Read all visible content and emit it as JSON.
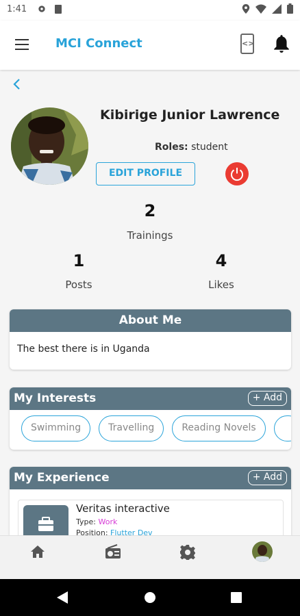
{
  "status_bar": {
    "time": "1:41"
  },
  "app_bar": {
    "title": "MCI Connect"
  },
  "profile": {
    "name": "Kibirige Junior Lawrence",
    "roles_label": "Roles:",
    "roles_value": "student",
    "edit_label": "EDIT PROFILE"
  },
  "stats": {
    "trainings": {
      "value": "2",
      "label": "Trainings"
    },
    "posts": {
      "value": "1",
      "label": "Posts"
    },
    "likes": {
      "value": "4",
      "label": "Likes"
    }
  },
  "about": {
    "title": "About Me",
    "text": "The best there is in Uganda"
  },
  "interests": {
    "title": "My Interests",
    "add_label": "+ Add",
    "items": [
      "Swimming",
      "Travelling",
      "Reading Novels"
    ]
  },
  "experience": {
    "title": "My Experience",
    "add_label": "+ Add",
    "items": [
      {
        "title": "Veritas interactive",
        "type_label": "Type:",
        "type_value": "Work",
        "position_label": "Position:",
        "position_value": "Flutter Dev"
      }
    ]
  },
  "colors": {
    "accent": "#29a3d9",
    "card_header": "#5c7684",
    "power": "#ea3b32",
    "type_value": "#d63ad6"
  },
  "icons": [
    "menu-icon",
    "code-icon",
    "bell-icon",
    "back-icon",
    "power-icon",
    "home-icon",
    "radio-icon",
    "gear-icon",
    "briefcase-icon"
  ]
}
